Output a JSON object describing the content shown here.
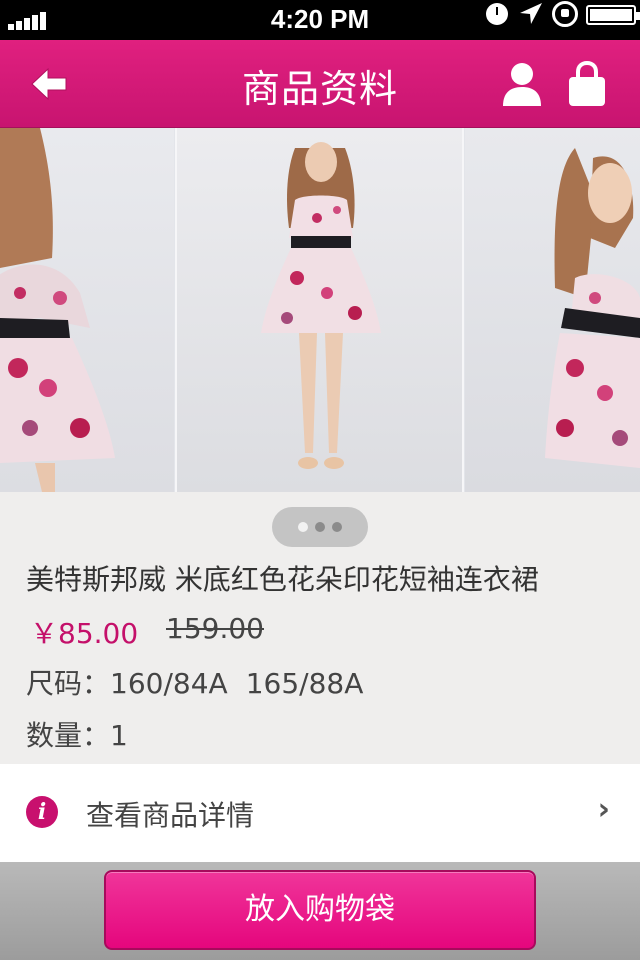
{
  "status_bar": {
    "time": "4:20 PM",
    "icons": [
      "signal-icon",
      "clock-icon",
      "location-icon",
      "rotation-lock-icon",
      "battery-icon"
    ]
  },
  "nav": {
    "title": "商品资料",
    "back_icon": "back-arrow-icon",
    "user_icon": "user-icon",
    "bag_icon": "shopping-bag-icon"
  },
  "gallery": {
    "dots": 3,
    "active_dot": 1
  },
  "product": {
    "name": "美特斯邦威 米底红色花朵印花短袖连衣裙",
    "price": "￥85.00",
    "original_price": "159.00",
    "size_label": "尺码：",
    "sizes": [
      "160/84A",
      "165/88A"
    ],
    "quantity_label": "数量：",
    "quantity": "1"
  },
  "details": {
    "icon": "info-icon",
    "icon_glyph": "i",
    "label": "查看商品详情",
    "chevron": "›"
  },
  "actions": {
    "add_to_bag": "放入购物袋"
  },
  "colors": {
    "brand_pink": "#c81470",
    "price_pink": "#c4106a",
    "button_pink": "#e5067d"
  }
}
